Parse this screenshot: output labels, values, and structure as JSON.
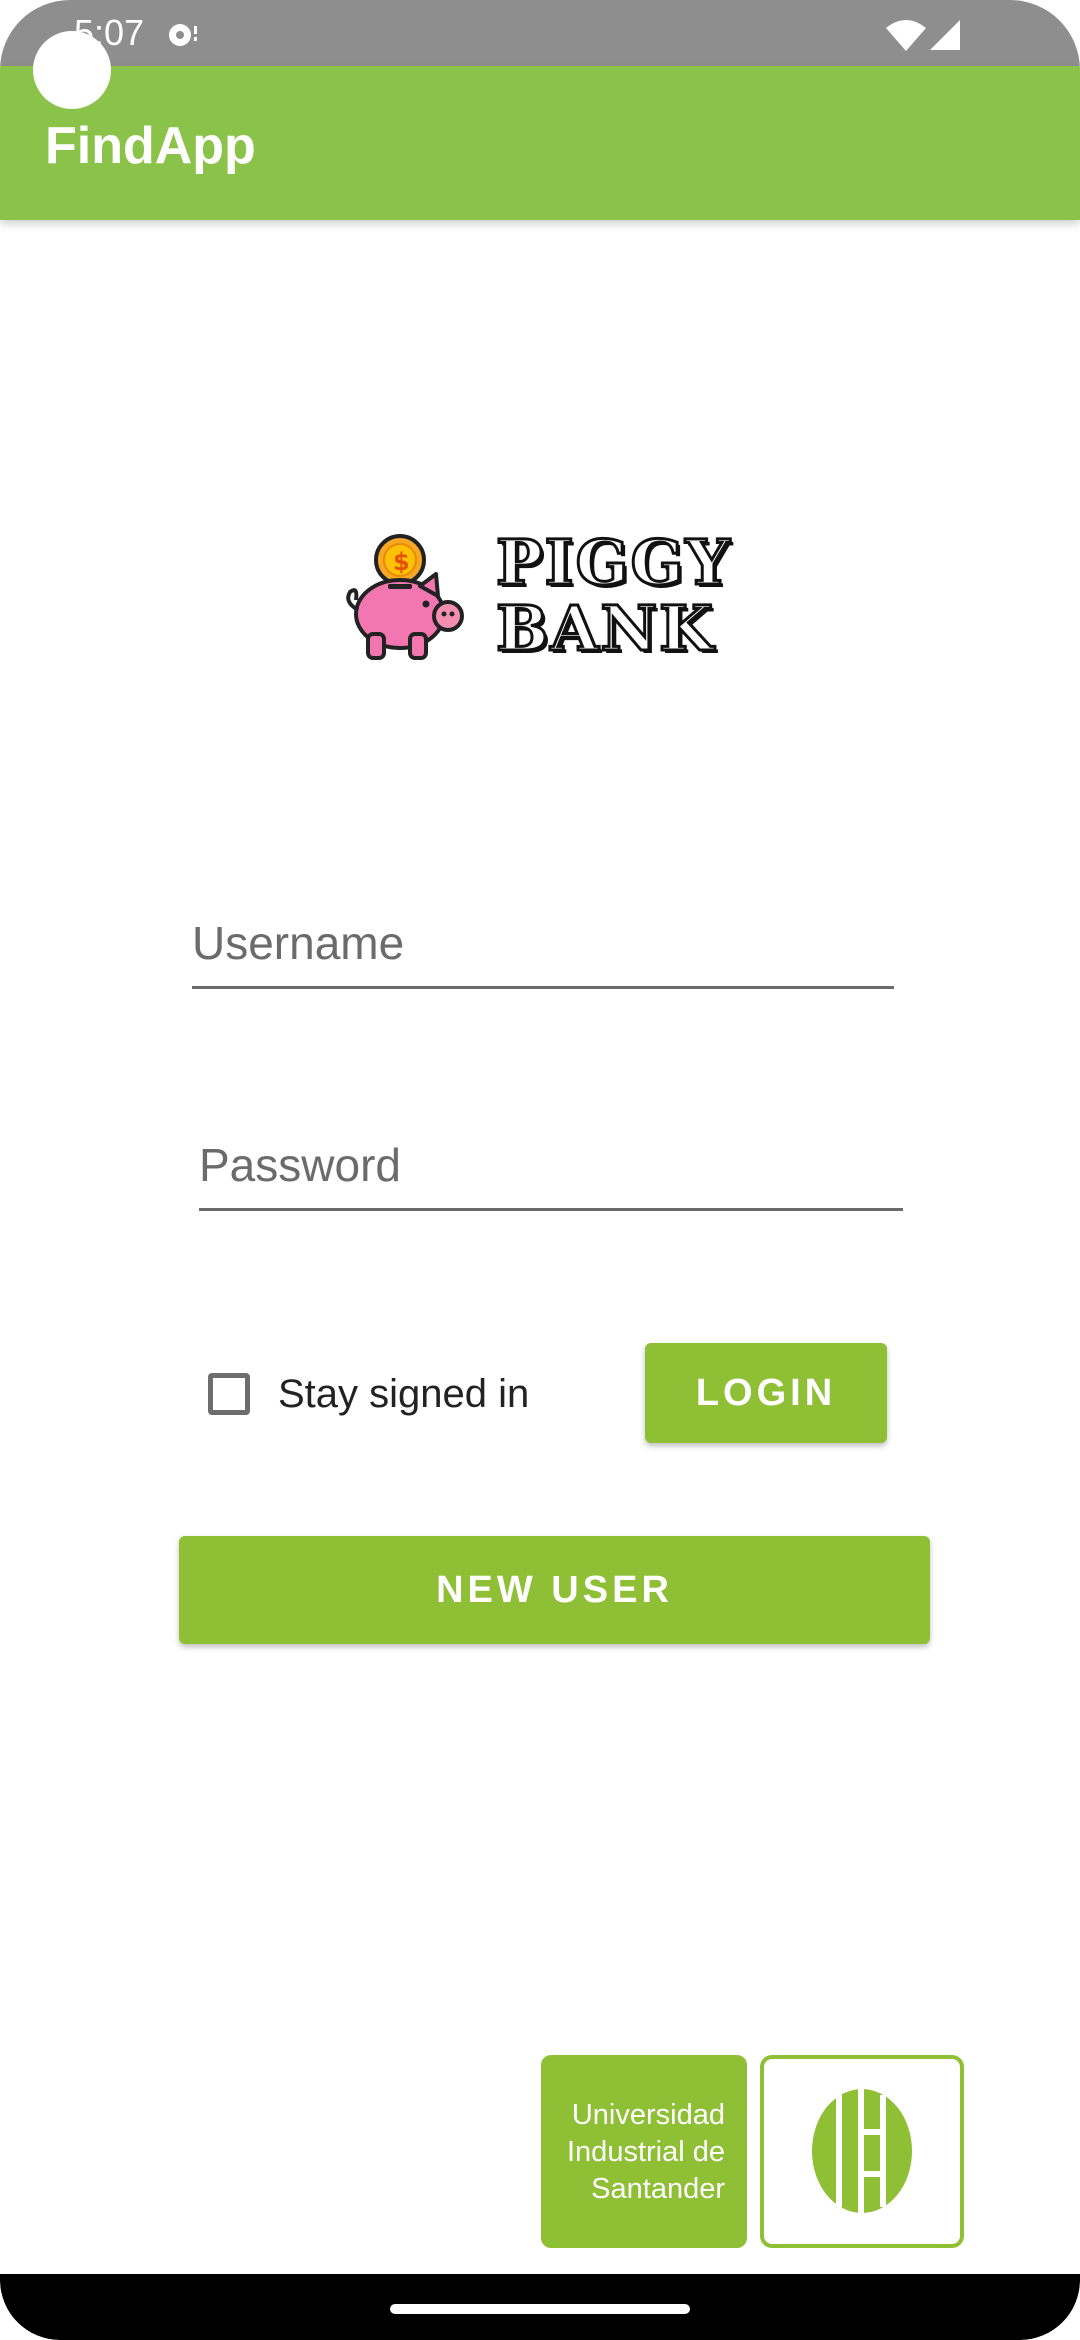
{
  "status_bar": {
    "time": "5:07",
    "icons": [
      "media-icon",
      "wifi-icon",
      "signal-icon"
    ]
  },
  "app_bar": {
    "title": "FindApp",
    "background": "#8bc34a"
  },
  "logo": {
    "line1": "PIGGY",
    "line2": "BANK",
    "icon": "piggy-bank-icon"
  },
  "form": {
    "username": {
      "value": "",
      "placeholder": "Username"
    },
    "password": {
      "value": "",
      "placeholder": "Password"
    },
    "stay_signed_in": {
      "label": "Stay signed in",
      "checked": false
    },
    "login_label": "LOGIN",
    "new_user_label": "NEW USER"
  },
  "footer_logo": {
    "line1": "Universidad",
    "line2": "Industrial de",
    "line3": "Santander",
    "emblem": "uis-emblem-icon"
  },
  "colors": {
    "accent": "#8ebf34",
    "app_bar": "#8bc34a",
    "status_bar": "#8e8e8e"
  }
}
